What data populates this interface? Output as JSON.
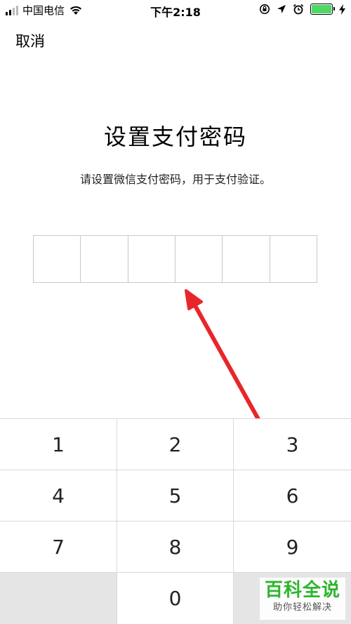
{
  "status_bar": {
    "carrier": "中国电信",
    "time": "下午2:18",
    "icons": [
      "signal-icon",
      "wifi-icon",
      "rotation-lock-icon",
      "location-icon",
      "alarm-icon",
      "battery-icon",
      "charging-icon"
    ]
  },
  "nav": {
    "cancel_label": "取消"
  },
  "header": {
    "title": "设置支付密码",
    "subtitle": "请设置微信支付密码，用于支付验证。"
  },
  "pin": {
    "length": 6
  },
  "keypad": {
    "keys": [
      "1",
      "2",
      "3",
      "4",
      "5",
      "6",
      "7",
      "8",
      "9",
      "",
      "0",
      ""
    ]
  },
  "watermark": {
    "main": "百科全说",
    "sub": "助你轻松解决"
  },
  "colors": {
    "arrow": "#e8262a",
    "watermark": "#2db52e",
    "battery": "#4cd964",
    "key_gray": "#e5e5e5"
  }
}
